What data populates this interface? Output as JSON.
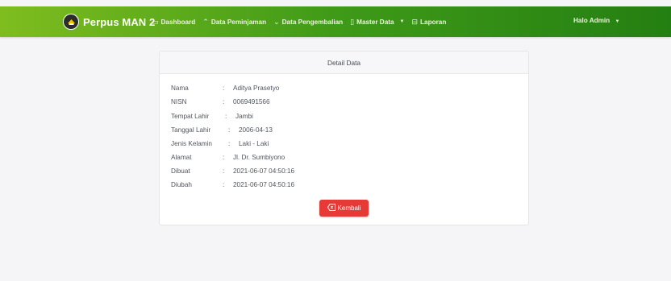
{
  "navbar": {
    "brand_icon": "school-logo-icon",
    "brand": "Perpus MAN 2",
    "items": [
      {
        "label": "Dashboard",
        "icon": "monitor-icon"
      },
      {
        "label": "Data Peminjaman",
        "icon": "chevron-up-icon"
      },
      {
        "label": "Data Pengembalian",
        "icon": "chevron-down-icon"
      },
      {
        "label": "Master Data",
        "icon": "book-icon",
        "dropdown": true
      },
      {
        "label": "Laporan",
        "icon": "report-icon"
      }
    ],
    "user": "Halo Admin"
  },
  "card": {
    "title": "Detail Data",
    "separator": ":",
    "rows": [
      {
        "label": "Nama",
        "value": "Aditya Prasetyo"
      },
      {
        "label": "NISN",
        "value": "0069491566"
      },
      {
        "label": "Tempat Lahir",
        "value": "Jambi"
      },
      {
        "label": "Tanggal Lahir",
        "value": "2006-04-13"
      },
      {
        "label": "Jenis Kelamin",
        "value": "Laki - Laki"
      },
      {
        "label": "Alamat",
        "value": "Jl. Dr. Sumbiyono"
      },
      {
        "label": "Dibuat",
        "value": "2021-06-07 04:50:16"
      },
      {
        "label": "Diubah",
        "value": "2021-06-07 04:50:16"
      }
    ],
    "back_button": "Kembali",
    "back_icon": "back-arrow-icon"
  },
  "colors": {
    "navbar_start": "#7fbd1f",
    "navbar_end": "#247f12",
    "button_red": "#e53a35",
    "background": "#f5f5f8"
  }
}
